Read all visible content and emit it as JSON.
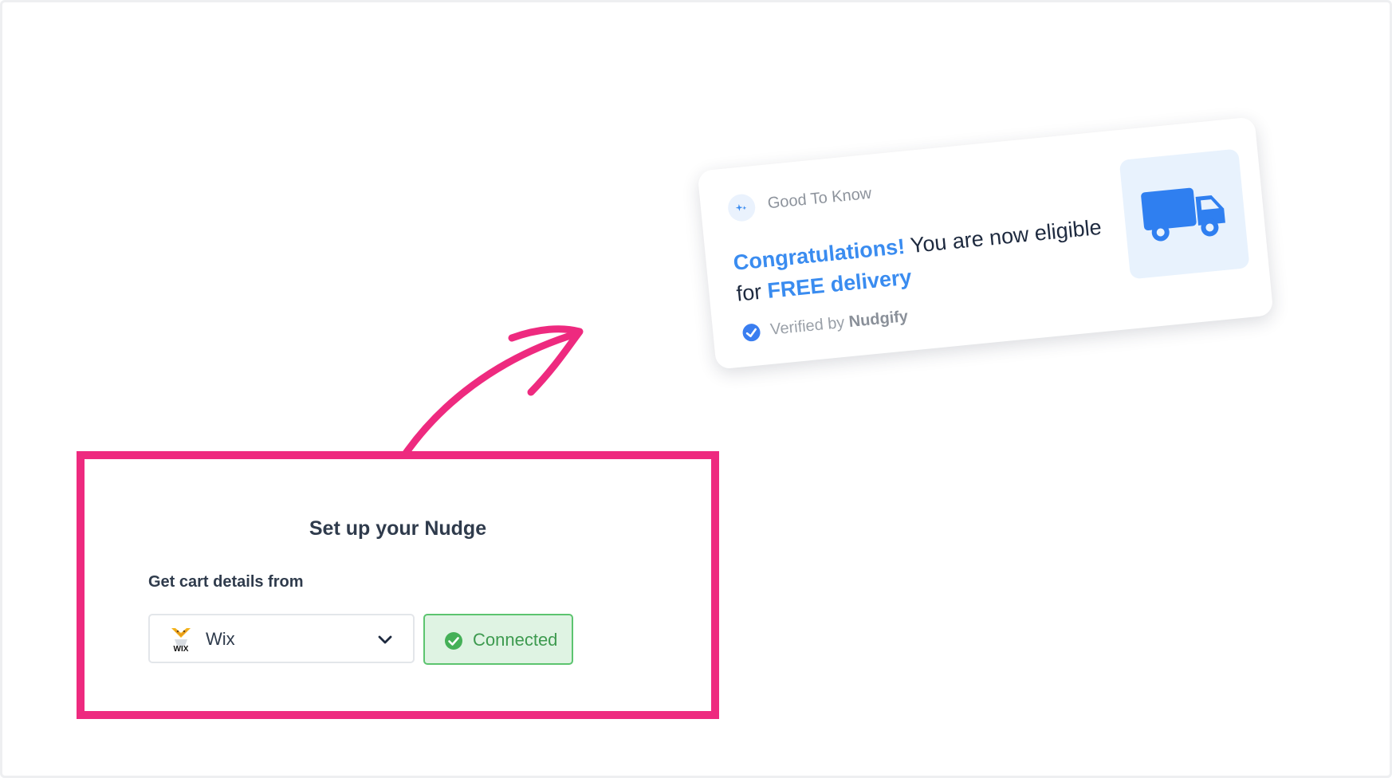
{
  "colors": {
    "highlight": "#ee2a7f",
    "accent_blue": "#3a8cf0",
    "connected_green": "#5cc46f",
    "text_dark": "#2f3b4c"
  },
  "setup": {
    "title": "Set up your Nudge",
    "label": "Get cart details from",
    "platform": {
      "selected": "Wix",
      "icon": "wix-logo-icon"
    },
    "status": {
      "label": "Connected",
      "icon": "check-circle-icon"
    }
  },
  "nudge": {
    "header": "Good To Know",
    "header_icon": "sparkle-icon",
    "message": {
      "highlight_1": "Congratulations!",
      "text_1": " You are now eligible for ",
      "highlight_2": "FREE delivery"
    },
    "verified_prefix": "Verified by ",
    "verified_brand": "Nudgify",
    "verified_icon": "verified-check-icon",
    "image_icon": "delivery-truck-icon"
  }
}
